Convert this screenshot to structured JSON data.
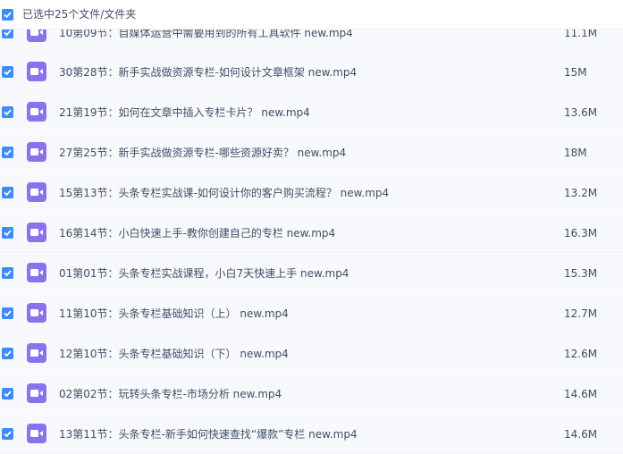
{
  "header": {
    "select_label": "已选中25个文件/文件夹"
  },
  "files": [
    {
      "name": "10第09节：自媒体运营中需要用到的所有工具软件 new.mp4",
      "size": "11.1M"
    },
    {
      "name": "30第28节：新手实战做资源专栏-如何设计文章框架 new.mp4",
      "size": "15M"
    },
    {
      "name": "21第19节：如何在文章中插入专栏卡片？ new.mp4",
      "size": "13.6M"
    },
    {
      "name": "27第25节：新手实战做资源专栏-哪些资源好卖？ new.mp4",
      "size": "18M"
    },
    {
      "name": "15第13节：头条专栏实战课-如何设计你的客户购买流程？ new.mp4",
      "size": "13.2M"
    },
    {
      "name": "16第14节：小白快速上手-教你创建自己的专栏 new.mp4",
      "size": "16.3M"
    },
    {
      "name": "01第01节：头条专栏实战课程，小白7天快速上手 new.mp4",
      "size": "15.3M"
    },
    {
      "name": "11第10节：头条专栏基础知识（上） new.mp4",
      "size": "12.7M"
    },
    {
      "name": "12第10节：头条专栏基础知识（下） new.mp4",
      "size": "12.6M"
    },
    {
      "name": "02第02节：玩转头条专栏-市场分析 new.mp4",
      "size": "14.6M"
    },
    {
      "name": "13第11节：头条专栏-新手如何快速查找“爆款”专栏 new.mp4",
      "size": "14.6M"
    }
  ],
  "colors": {
    "checkbox": "#3b8cff",
    "video_icon": "#8a72ee",
    "row_bg": "#f7f9fc"
  },
  "icons": {
    "checkbox": "check-icon",
    "file": "video-file-icon"
  }
}
